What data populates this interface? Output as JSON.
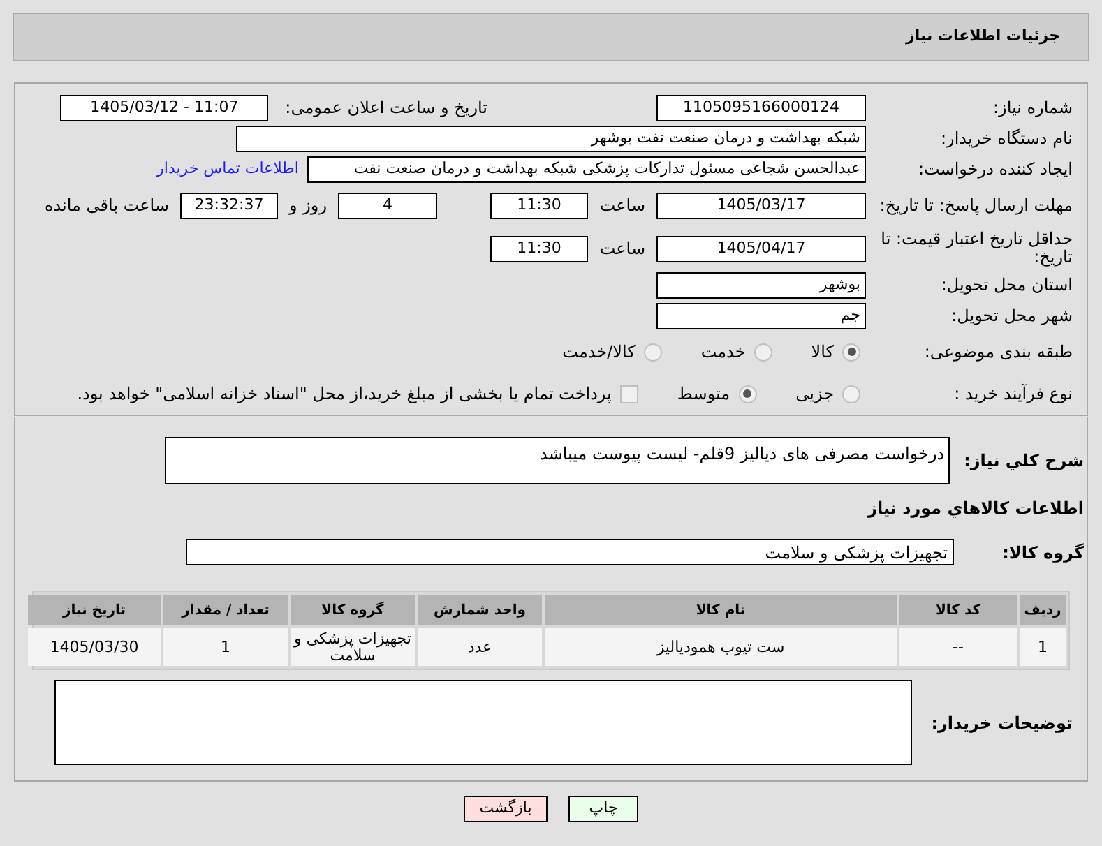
{
  "header": {
    "title": "جزئیات اطلاعات نیاز"
  },
  "details": {
    "need_number": {
      "label": "شماره نیاز:",
      "value": "1105095166000124"
    },
    "announce": {
      "label": "تاریخ و ساعت اعلان عمومی:",
      "value": "1405/03/12 - 11:07"
    },
    "buyer_org": {
      "label": "نام دستگاه خریدار:",
      "value": "شبکه بهداشت و درمان صنعت نفت بوشهر"
    },
    "requester": {
      "label": "ایجاد کننده درخواست:",
      "value": "عبدالحسن شجاعی مسئول تدارکات پزشکی شبکه بهداشت و درمان صنعت نفت",
      "contact_link": "اطلاعات تماس خریدار"
    },
    "reply_deadline": {
      "label": "مهلت ارسال پاسخ: تا تاریخ:",
      "date": "1405/03/17",
      "time_label": "ساعت",
      "time": "11:30",
      "days": "4",
      "days_label": "روز و",
      "remaining": "23:32:37",
      "remaining_label": "ساعت باقی مانده"
    },
    "price_validity": {
      "label": "حداقل تاریخ اعتبار قیمت: تا تاریخ:",
      "date": "1405/04/17",
      "time_label": "ساعت",
      "time": "11:30"
    },
    "province": {
      "label": "استان محل تحویل:",
      "value": "بوشهر"
    },
    "city": {
      "label": "شهر محل تحویل:",
      "value": "جم"
    },
    "category": {
      "label": "طبقه بندی موضوعی:",
      "options": [
        {
          "label": "کالا",
          "selected": true
        },
        {
          "label": "خدمت",
          "selected": false
        },
        {
          "label": "کالا/خدمت",
          "selected": false
        }
      ]
    },
    "purchase_type": {
      "label": "نوع فرآیند خرید :",
      "options": [
        {
          "label": "جزیی",
          "selected": false
        },
        {
          "label": "متوسط",
          "selected": true
        }
      ],
      "treasury": {
        "label": "پرداخت تمام یا بخشی از مبلغ خرید،از محل \"اسناد خزانه اسلامی\" خواهد بود.",
        "checked": false
      }
    }
  },
  "description": {
    "label": "شرح کلي نياز:",
    "value": "درخواست مصرفی های دیالیز 9قلم- لیست پیوست میباشد"
  },
  "goods_title": "اطلاعات کالاهاي مورد نياز",
  "goods_group": {
    "label": "گروه کالا:",
    "value": "تجهیزات پزشکی و سلامت"
  },
  "table": {
    "columns": [
      "ردیف",
      "کد کالا",
      "نام کالا",
      "واحد شمارش",
      "گروه کالا",
      "تعداد / مقدار",
      "تاریخ نیاز"
    ],
    "rows": [
      [
        "1",
        "--",
        "ست تیوب همودیالیز",
        "عدد",
        "تجهیزات پزشکی و سلامت",
        "1",
        "1405/03/30"
      ]
    ]
  },
  "buyer_notes": {
    "label": "توضیحات خریدار:"
  },
  "buttons": [
    {
      "label": "چاپ",
      "kind": "print"
    },
    {
      "label": "بازگشت",
      "kind": "back"
    }
  ]
}
